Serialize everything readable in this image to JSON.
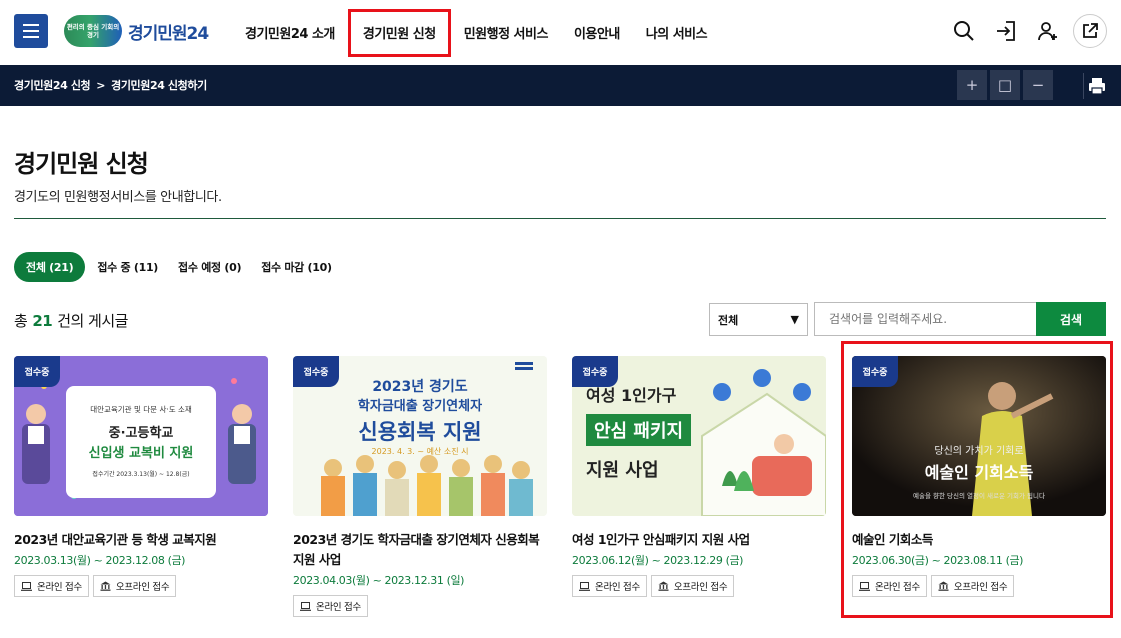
{
  "header": {
    "logo_tagline": "편리의 중심 기회의 경기",
    "logo_text": "경기민원24",
    "nav": [
      {
        "label": "경기민원24 소개"
      },
      {
        "label": "경기민원 신청"
      },
      {
        "label": "민원행정 서비스"
      },
      {
        "label": "이용안내"
      },
      {
        "label": "나의 서비스"
      }
    ],
    "icons": [
      "search-icon",
      "login-icon",
      "join-icon",
      "external-link-icon"
    ]
  },
  "breadcrumb": {
    "items": [
      "경기민원24 신청",
      "경기민원24 신청하기"
    ],
    "separator": ">"
  },
  "zoom": {
    "plus": "+",
    "reset": "□",
    "minus": "−"
  },
  "page": {
    "title": "경기민원 신청",
    "subtitle": "경기도의 민원행정서비스를 안내합니다."
  },
  "tabs": [
    {
      "label": "전체 (21)",
      "active": true
    },
    {
      "label": "접수 중 (11)",
      "active": false
    },
    {
      "label": "접수 예정 (0)",
      "active": false
    },
    {
      "label": "접수 마감 (10)",
      "active": false
    }
  ],
  "listing": {
    "count_prefix": "총",
    "count": "21",
    "count_suffix": "건의 게시글"
  },
  "search": {
    "select_value": "전체",
    "placeholder": "검색어를 입력해주세요.",
    "button": "검색"
  },
  "cards": [
    {
      "badge": "접수중",
      "title": "2023년 대안교육기관 등 학생 교복지원",
      "date": "2023.03.13(월) ~ 2023.12.08 (금)",
      "buttons": [
        "온라인 접수",
        "오프라인 접수"
      ],
      "thumb": {
        "line1": "대안교육기관 및 다문 사·도 소재",
        "line2": "중·고등학교",
        "line3": "신입생 교복비 지원",
        "line4": "접수기간 2023.3.13(월) ~ 12.8(금)"
      }
    },
    {
      "badge": "접수중",
      "title": "2023년 경기도 학자금대출 장기연체자 신용회복 지원 사업",
      "date": "2023.04.03(월) ~ 2023.12.31 (일)",
      "buttons": [
        "온라인 접수"
      ],
      "thumb": {
        "line1": "2023년 경기도",
        "line2": "학자금대출 장기연체자",
        "line3": "신용회복 지원",
        "line4": "2023. 4. 3. ~ 예산 소진 시"
      }
    },
    {
      "badge": "접수중",
      "title": "여성 1인가구 안심패키지 지원 사업",
      "date": "2023.06.12(월) ~ 2023.12.29 (금)",
      "buttons": [
        "온라인 접수",
        "오프라인 접수"
      ],
      "thumb": {
        "line1": "여성 1인가구",
        "line2": "안심 패키지",
        "line3": "지원 사업"
      }
    },
    {
      "badge": "접수중",
      "title": "예술인 기회소득",
      "date": "2023.06.30(금) ~ 2023.08.11 (금)",
      "buttons": [
        "온라인 접수",
        "오프라인 접수"
      ],
      "thumb": {
        "line1": "당신의 가치가 기회로",
        "line2": "예술인 기회소득",
        "line3": "예술을 향한 당신의 열정이 새로운 기회가 됩니다"
      }
    }
  ],
  "colors": {
    "brand_blue": "#1f4c9c",
    "green": "#0d7b3c",
    "dark_bar": "#0c1b36",
    "badge": "#1a3a8c",
    "highlight_red": "#e8121a"
  }
}
